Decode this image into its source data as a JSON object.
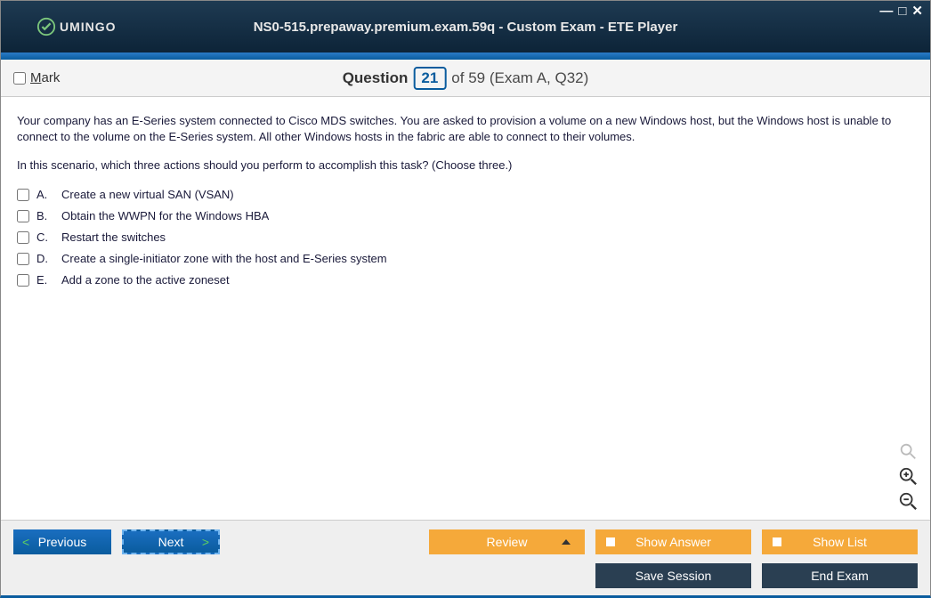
{
  "window": {
    "title": "NS0-515.prepaway.premium.exam.59q - Custom Exam - ETE Player",
    "logo_text": "UMINGO"
  },
  "header": {
    "mark_label": "Mark",
    "question_word": "Question",
    "current": "21",
    "total": "of 59 (Exam A, Q32)"
  },
  "question": {
    "para1": "Your company has an E-Series system connected to Cisco MDS switches. You are asked to provision a volume on a new Windows host, but the Windows host is unable to connect to the volume on the E-Series system. All other Windows hosts in the fabric are able to connect to their volumes.",
    "para2": "In this scenario, which three actions should you perform to accomplish this task? (Choose three.)"
  },
  "answers": [
    {
      "letter": "A.",
      "text": "Create a new virtual SAN (VSAN)"
    },
    {
      "letter": "B.",
      "text": "Obtain the WWPN for the Windows HBA"
    },
    {
      "letter": "C.",
      "text": "Restart the switches"
    },
    {
      "letter": "D.",
      "text": "Create a single-initiator zone with the host and E-Series system"
    },
    {
      "letter": "E.",
      "text": "Add a zone to the active zoneset"
    }
  ],
  "footer": {
    "previous": "Previous",
    "next": "Next",
    "review": "Review",
    "show_answer": "Show Answer",
    "show_list": "Show List",
    "save_session": "Save Session",
    "end_exam": "End Exam"
  }
}
